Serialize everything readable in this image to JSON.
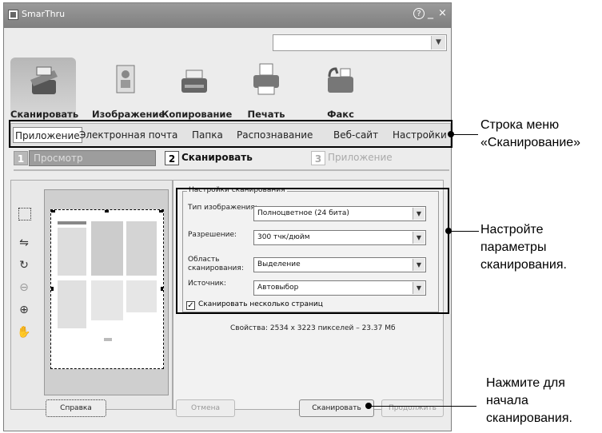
{
  "window": {
    "title": "SmarThru",
    "help_icon": "?",
    "min_icon": "_",
    "close_icon": "×"
  },
  "toolbar": [
    {
      "label": "Сканировать",
      "icon": "scanner-icon",
      "active": true
    },
    {
      "label": "Изображение",
      "icon": "image-icon",
      "active": false
    },
    {
      "label": "Копирование",
      "icon": "copier-icon",
      "active": false
    },
    {
      "label": "Печать",
      "icon": "printer-icon",
      "active": false
    },
    {
      "label": "Факс",
      "icon": "fax-icon",
      "active": false
    }
  ],
  "menu": [
    "Приложение",
    "Электронная почта",
    "Папка",
    "Распознавание",
    "Веб-сайт",
    "Настройки"
  ],
  "steps": [
    {
      "num": "1",
      "label": "Просмотр"
    },
    {
      "num": "2",
      "label": "Сканировать"
    },
    {
      "num": "3",
      "label": "Приложение"
    }
  ],
  "settings": {
    "group_title": "Настройки сканирования",
    "fields": [
      {
        "label": "Тип изображения:",
        "value": "Полноцветное (24 бита)"
      },
      {
        "label": "Разрешение:",
        "value": "300 тчк/дюйм"
      },
      {
        "label": "Область сканирования:",
        "value": "Выделение"
      },
      {
        "label": "Источник:",
        "value": "Автовыбор"
      }
    ],
    "multi_page_label": "Сканировать несколько страниц",
    "multi_page_checked": true,
    "properties": "Свойства: 2534 x 3223 пикселей – 23.37 Мб"
  },
  "buttons": {
    "help": "Справка",
    "cancel": "Отмена",
    "scan": "Сканировать",
    "continue": "Продолжить"
  },
  "callouts": {
    "menu": [
      "Строка меню",
      "«Сканирование»"
    ],
    "settings": [
      "Настройте",
      "параметры",
      "сканирования."
    ],
    "scan": [
      "Нажмите для",
      "начала",
      "сканирования."
    ]
  }
}
